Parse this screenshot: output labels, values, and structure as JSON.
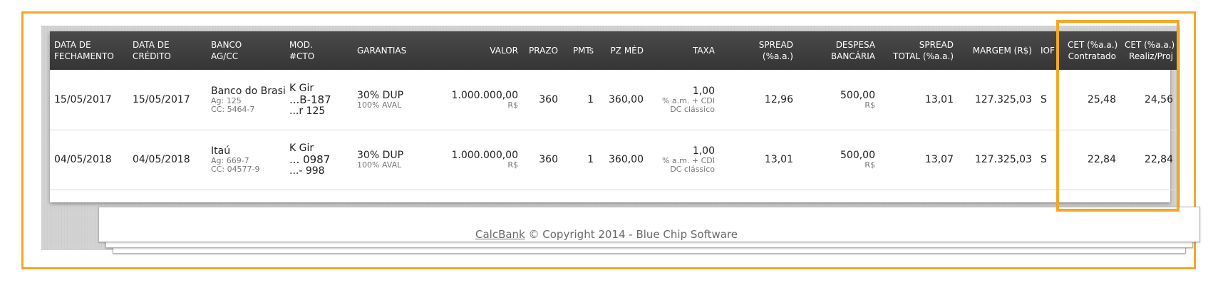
{
  "table": {
    "headers": [
      {
        "l1": "DATA DE",
        "l2": "FECHAMENTO"
      },
      {
        "l1": "DATA DE",
        "l2": "CRÉDITO"
      },
      {
        "l1": "BANCO",
        "l2": "AG/CC"
      },
      {
        "l1": "MOD.",
        "l2": "#CTO"
      },
      {
        "l1": "GARANTIAS",
        "l2": ""
      },
      {
        "l1": "VALOR",
        "l2": ""
      },
      {
        "l1": "PRAZO",
        "l2": ""
      },
      {
        "l1": "PMTs",
        "l2": ""
      },
      {
        "l1": "PZ MÉD",
        "l2": ""
      },
      {
        "l1": "TAXA",
        "l2": ""
      },
      {
        "l1": "SPREAD",
        "l2": "(%a.a.)"
      },
      {
        "l1": "DESPESA",
        "l2": "BANCÁRIA"
      },
      {
        "l1": "SPREAD",
        "l2": "TOTAL (%a.a.)"
      },
      {
        "l1": "MARGEM (R$)",
        "l2": ""
      },
      {
        "l1": "IOF",
        "l2": ""
      },
      {
        "l1": "CET (%a.a.)",
        "l2": "Contratado"
      },
      {
        "l1": "CET (%a.a.)",
        "l2": "Realiz/Proj"
      }
    ],
    "rows": [
      {
        "fechamento": "15/05/2017",
        "credito": "15/05/2017",
        "banco": "Banco do Brasil",
        "ag": "Ag: 125",
        "cc": "CC: 5464-7",
        "mod": "K Gir",
        "cto1": "...B-187",
        "cto2": "...r 125",
        "garantia": "30% DUP",
        "garantia_sub": "100% AVAL",
        "valor": "1.000.000,00",
        "valor_moeda": "R$",
        "prazo": "360",
        "pmts": "1",
        "pz_med": "360,00",
        "taxa": "1,00",
        "taxa_sub1": "% a.m. + CDI",
        "taxa_sub2": "DC clássico",
        "spread": "12,96",
        "despesa": "500,00",
        "despesa_moeda": "R$",
        "spread_total": "13,01",
        "margem": "127.325,03",
        "iof": "S",
        "cet_contratado": "25,48",
        "cet_realiz": "24,56"
      },
      {
        "fechamento": "04/05/2018",
        "credito": "04/05/2018",
        "banco": "Itaú",
        "ag": "Ag: 669-7",
        "cc": "CC: 04577-9",
        "mod": "K Gir",
        "cto1": "... 0987",
        "cto2": "...- 998",
        "garantia": "30% DUP",
        "garantia_sub": "100% AVAL",
        "valor": "1.000.000,00",
        "valor_moeda": "R$",
        "prazo": "360",
        "pmts": "1",
        "pz_med": "360,00",
        "taxa": "1,00",
        "taxa_sub1": "% a.m. + CDI",
        "taxa_sub2": "DC clássico",
        "spread": "13,01",
        "despesa": "500,00",
        "despesa_moeda": "R$",
        "spread_total": "13,07",
        "margem": "127.325,03",
        "iof": "S",
        "cet_contratado": "22,84",
        "cet_realiz": "22,84"
      }
    ]
  },
  "footer": {
    "link": "CalcBank",
    "text": " © Copyright 2014 - Blue Chip Software"
  },
  "colors": {
    "highlight": "#f2a825",
    "header_bg": "#3f3f3f"
  }
}
